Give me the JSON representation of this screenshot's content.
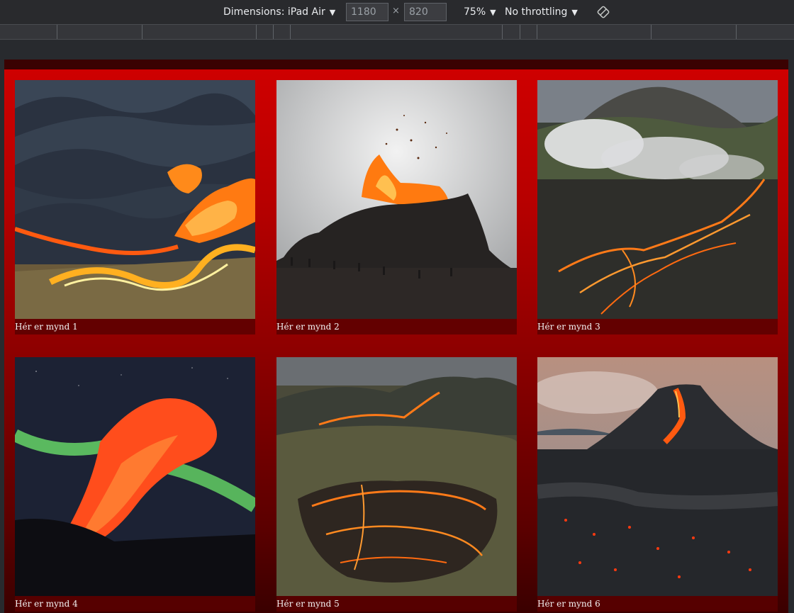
{
  "toolbar": {
    "dimensions_label": "Dimensions: iPad Air",
    "width_value": "1180",
    "height_value": "820",
    "times": "×",
    "zoom": "75%",
    "throttling": "No throttling"
  },
  "gallery": {
    "cards": [
      {
        "caption": "Hér er mynd 1"
      },
      {
        "caption": "Hér er mynd 2"
      },
      {
        "caption": "Hér er mynd 3"
      },
      {
        "caption": "Hér er mynd 4"
      },
      {
        "caption": "Hér er mynd 5"
      },
      {
        "caption": "Hér er mynd 6"
      }
    ]
  },
  "colors": {
    "page_top": "#d00000",
    "page_bottom": "#3a0000",
    "toolbar_bg": "#292a2d"
  }
}
